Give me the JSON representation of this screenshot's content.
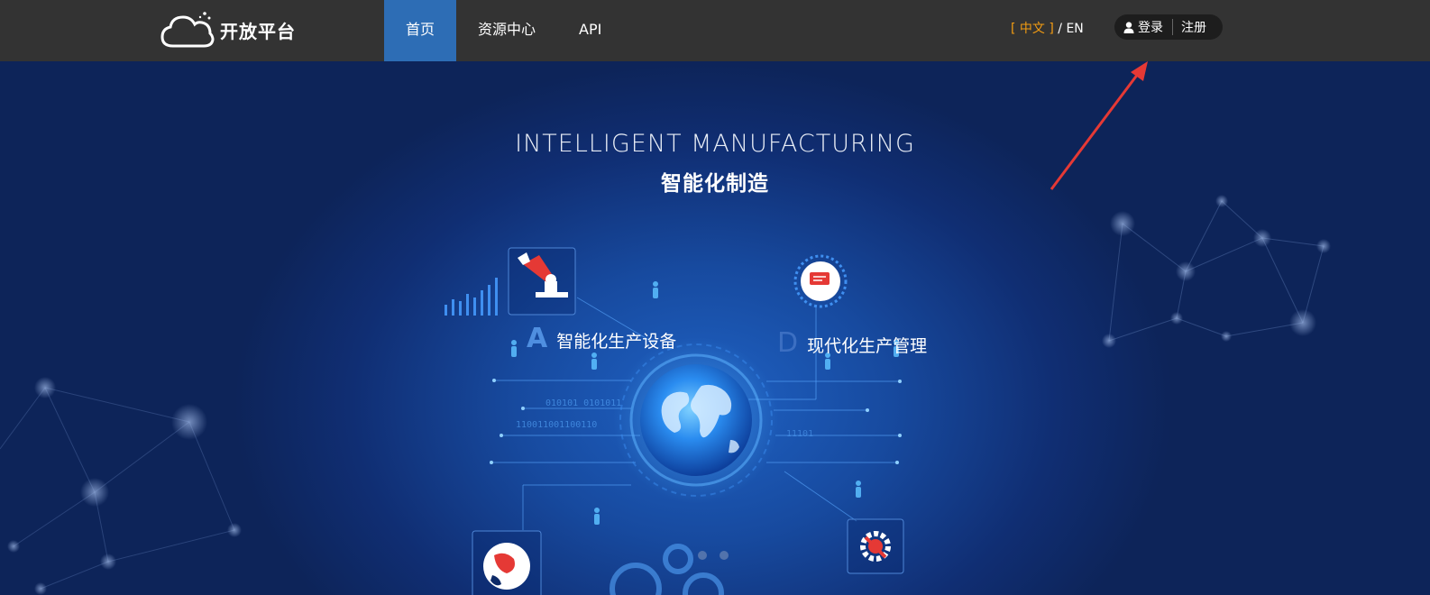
{
  "header": {
    "logo_text": "开放平台",
    "nav": [
      {
        "label": "首页",
        "active": true
      },
      {
        "label": "资源中心",
        "active": false
      },
      {
        "label": "API",
        "active": false
      }
    ],
    "lang_zh": "[ 中文 ]",
    "lang_sep": "/",
    "lang_en": "EN",
    "login": "登录",
    "register": "注册"
  },
  "hero": {
    "title_en": "INTELLIGENT MANUFACTURING",
    "title_zh": "智能化制造",
    "feature_a": {
      "letter": "A",
      "label": "智能化生产设备"
    },
    "feature_d": {
      "letter": "D",
      "label": "现代化生产管理"
    },
    "binary_1": "010101 0101011",
    "binary_2": "110011001100110",
    "binary_3": "11101"
  },
  "colors": {
    "topbar": "#333333",
    "nav_active": "#2d6db5",
    "lang_active": "#f39c12",
    "annotation_arrow": "#e53935"
  }
}
